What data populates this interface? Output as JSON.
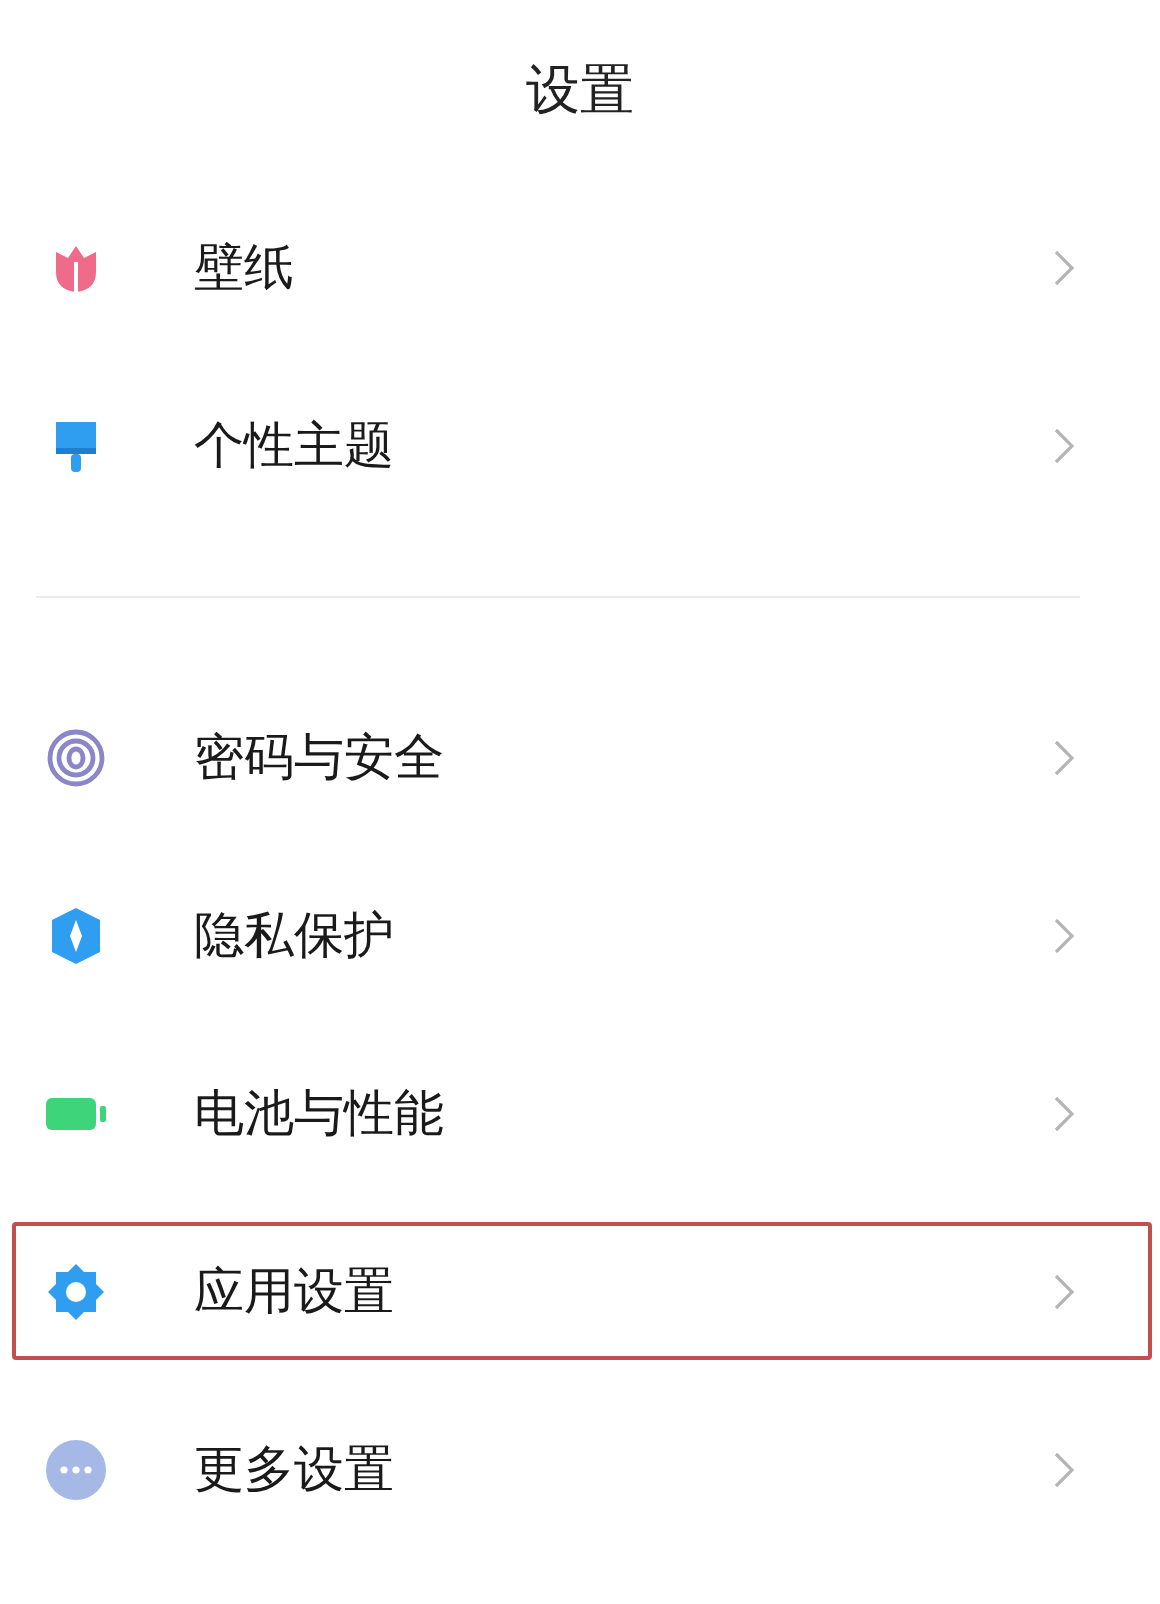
{
  "title": "设置",
  "groups": [
    {
      "items": [
        {
          "label": "壁纸",
          "selected": false
        },
        {
          "label": "个性主题",
          "selected": false
        }
      ]
    },
    {
      "items": [
        {
          "label": "密码与安全",
          "selected": false
        },
        {
          "label": "隐私保护",
          "selected": false
        },
        {
          "label": "电池与性能",
          "selected": false
        },
        {
          "label": "应用设置",
          "selected": true
        },
        {
          "label": "更多设置",
          "selected": false
        }
      ]
    }
  ]
}
